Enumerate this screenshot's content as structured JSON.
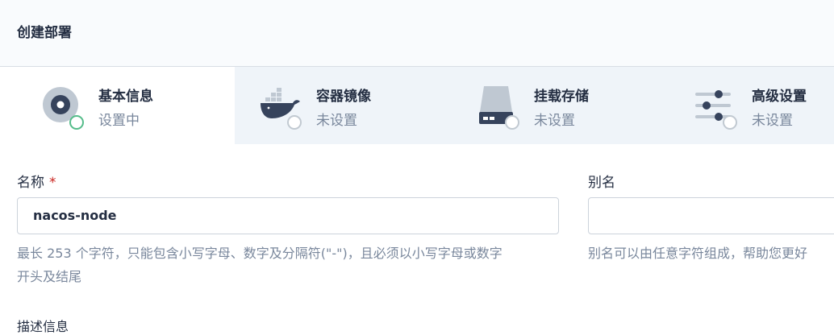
{
  "header": {
    "title": "创建部署"
  },
  "steps": [
    {
      "label": "基本信息",
      "status": "设置中",
      "icon": "disk-icon",
      "active": true
    },
    {
      "label": "容器镜像",
      "status": "未设置",
      "icon": "docker-whale-icon",
      "active": false
    },
    {
      "label": "挂载存储",
      "status": "未设置",
      "icon": "storage-drive-icon",
      "active": false
    },
    {
      "label": "高级设置",
      "status": "未设置",
      "icon": "sliders-icon",
      "active": false
    }
  ],
  "form": {
    "name": {
      "label": "名称",
      "required_mark": "*",
      "value": "nacos-node",
      "hint_line1": "最长 253 个字符，只能包含小写字母、数字及分隔符(\"-\")，且必须以小写字母或数字",
      "hint_line2": "开头及结尾"
    },
    "alias": {
      "label": "别名",
      "value": "",
      "hint": "别名可以由任意字符组成，帮助您更好"
    },
    "next_label": "描述信息"
  },
  "colors": {
    "accent_green": "#55bc8a",
    "required_red": "#ca2621",
    "muted_text": "#79879c",
    "icon_gray": "#bfc8d2",
    "icon_dark": "#36435c"
  }
}
